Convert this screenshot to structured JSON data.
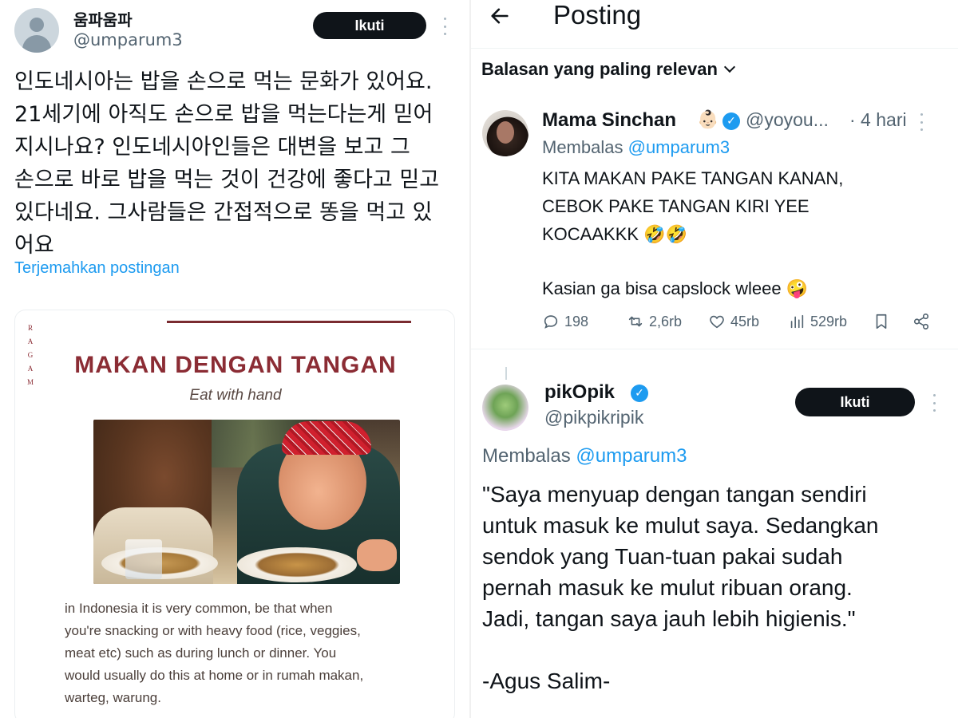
{
  "left_post": {
    "author_name": "움파움파",
    "author_handle": "@umparum3",
    "follow_label": "Ikuti",
    "text_lines": [
      "인도네시아는 밥을 손으로 먹는 문화가 있어요.",
      "21세기에 아직도 손으로 밥을 먹는다는게 믿어",
      "지시나요? 인도네시아인들은 대변을 보고 그",
      "손으로 바로 밥을 먹는 것이 건강에 좋다고 믿고",
      "있다네요. 그사람들은 간접적으로 똥을 먹고 있",
      "어요"
    ],
    "translate_link": "Terjemahkan postingan",
    "card": {
      "brand_letters": [
        "R",
        "A",
        "G",
        "A",
        "M"
      ],
      "title": "MAKAN DENGAN TANGAN",
      "subtitle": "Eat with hand",
      "description_lines": [
        "in Indonesia it is very common, be that when",
        "you're snacking or with heavy food (rice, veggies,",
        "meat etc) such as during lunch or dinner. You",
        "would usually do this at home or in rumah makan,",
        "warteg, warung."
      ]
    }
  },
  "right_panel": {
    "header_title": "Posting",
    "sort_label": "Balasan yang paling relevan",
    "reply1": {
      "name": "Mama Sinchan",
      "name_emoji": "👶🏻",
      "handle": "@yoyou...",
      "time": "· 4 hari",
      "replying_prefix": "Membalas",
      "replying_to": "@umparum3",
      "body_lines": [
        "KITA MAKAN PAKE TANGAN KANAN,",
        "CEBOK PAKE TANGAN KIRI YEE",
        "KOCAAKKK 🤣🤣"
      ],
      "body_lines_2": [
        "Kasian ga bisa capslock wleee 🤪"
      ],
      "stats": {
        "replies": "198",
        "reposts": "2,6rb",
        "likes": "45rb",
        "views": "529rb"
      }
    },
    "reply2": {
      "name": "pikOpik",
      "handle": "@pikpikripik",
      "follow_label": "Ikuti",
      "replying_prefix": "Membalas",
      "replying_to": "@umparum3",
      "body_lines": [
        "\"Saya menyuap dengan tangan sendiri",
        "untuk masuk ke mulut saya. Sedangkan",
        "sendok yang Tuan-tuan pakai sudah",
        "pernah masuk ke mulut ribuan orang.",
        "Jadi, tangan saya jauh lebih higienis.\""
      ],
      "signature": "-Agus Salim-"
    }
  },
  "colors": {
    "accent": "#1d9bf0",
    "text": "#0f1419",
    "muted": "#536471",
    "card_title": "#8b2c34"
  }
}
